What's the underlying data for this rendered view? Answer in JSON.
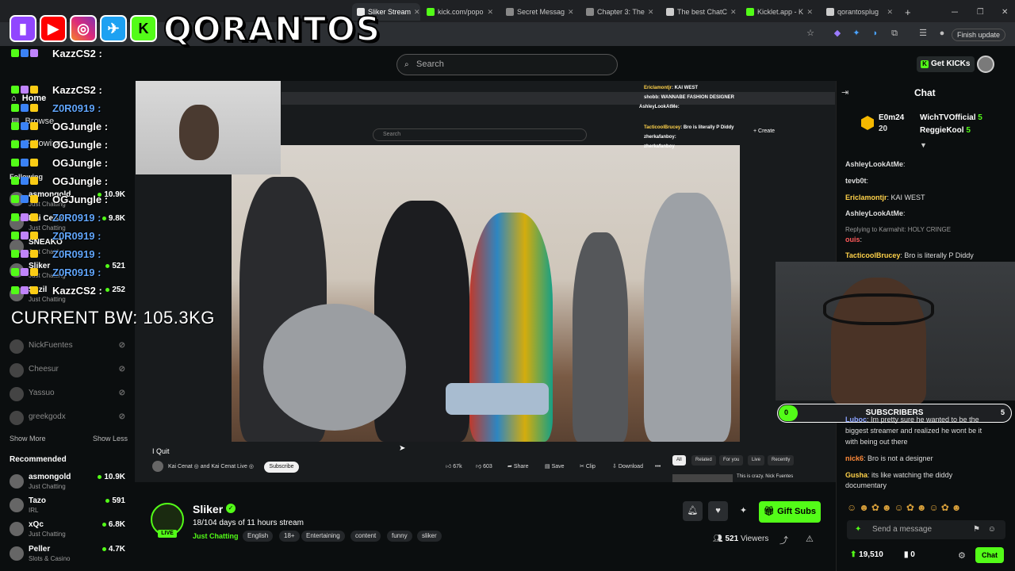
{
  "browser": {
    "tabs": [
      {
        "label": "Sliker Stream",
        "active": true,
        "color": "#e8e8e8"
      },
      {
        "label": "kick.com/popo",
        "color": "#53fc18"
      },
      {
        "label": "Secret Messag",
        "color": "#888888"
      },
      {
        "label": "Chapter 3: The",
        "color": "#888888"
      },
      {
        "label": "The best ChatC",
        "color": "#cccccc"
      },
      {
        "label": "Kicklet.app - K",
        "color": "#53fc18"
      },
      {
        "label": "qorantosplug",
        "color": "#cccccc"
      }
    ],
    "finish_update": "Finish update",
    "new_tab": "+"
  },
  "overlay": {
    "brand": "QORANTOS",
    "social_icons": [
      "twitch-icon",
      "youtube-icon",
      "instagram-icon",
      "twitter-icon",
      "kick-icon"
    ],
    "bw_counter": "CURRENT BW: 105.3KG",
    "chat": [
      {
        "name": "KazzCS2",
        "sep": ":",
        "color": "#ffffff"
      },
      {
        "name": "KazzCS2",
        "sep": ":",
        "color": "#ffffff"
      },
      {
        "name": "Z0R0919",
        "sep": ":",
        "color": "#3b82f6"
      },
      {
        "name": "OGJungle",
        "sep": ":",
        "color": "#ffffff"
      },
      {
        "name": "OGJungle",
        "sep": ":",
        "color": "#ffffff"
      },
      {
        "name": "OGJungle",
        "sep": ":",
        "color": "#ffffff"
      },
      {
        "name": "OGJungle",
        "sep": ":",
        "color": "#ffffff"
      },
      {
        "name": "OGJungle",
        "sep": ":",
        "color": "#ffffff"
      },
      {
        "name": "Z0R0919",
        "sep": ":",
        "color": "#3b82f6"
      },
      {
        "name": "Z0R0919",
        "sep": ":",
        "color": "#3b82f6"
      },
      {
        "name": "Z0R0919",
        "sep": ":",
        "color": "#3b82f6"
      },
      {
        "name": "Z0R0919",
        "sep": ":",
        "color": "#3b82f6"
      },
      {
        "name": "KazzCS2",
        "sep": ":",
        "color": "#ffffff"
      }
    ]
  },
  "header": {
    "search_placeholder": "Search",
    "get_kicks": "Get KICKs"
  },
  "sidebar": {
    "nav": [
      {
        "label": "Home"
      },
      {
        "label": "Browse"
      },
      {
        "label": "Following"
      }
    ],
    "section_following": "Following",
    "following": [
      {
        "name": "asmongold",
        "sub": "Just Chatting",
        "count": "10.9K",
        "live": true
      },
      {
        "name": "Kai Cenat",
        "sub": "Just Chatting",
        "count": "9.8K",
        "live": true
      },
      {
        "name": "SNEAKO",
        "sub": "Just Chatting",
        "count": "",
        "live": true
      },
      {
        "name": "Sliker",
        "sub": "Just Chatting",
        "count": "521",
        "live": true
      },
      {
        "name": "Suzil",
        "sub": "Just Chatting",
        "count": "252",
        "live": true
      },
      {
        "name": "NickFuentes",
        "sub": "",
        "count": "",
        "live": false
      },
      {
        "name": "Cheesur",
        "sub": "",
        "count": "",
        "live": false
      },
      {
        "name": "Yassuo",
        "sub": "",
        "count": "",
        "live": false
      },
      {
        "name": "greekgodx",
        "sub": "",
        "count": "",
        "live": false
      }
    ],
    "show_more": "Show More",
    "show_less": "Show Less",
    "section_recommended": "Recommended",
    "recommended": [
      {
        "name": "asmongold",
        "sub": "Just Chatting",
        "count": "10.9K"
      },
      {
        "name": "Tazo",
        "sub": "IRL",
        "count": "591"
      },
      {
        "name": "xQc",
        "sub": "Just Chatting",
        "count": "6.8K"
      },
      {
        "name": "Peller",
        "sub": "Slots & Casino",
        "count": "4.7K"
      }
    ]
  },
  "stream": {
    "inner_search": "Search",
    "inner_create": "+ Create",
    "video_title": "I Quit",
    "video_channel": "Kai Cenat ◎ and Kai Cenat Live ◎",
    "subscribe": "Subscribe",
    "likes": "67k",
    "dislikes": "603",
    "share": "Share",
    "save": "Save",
    "clip": "Clip",
    "download": "Download",
    "chips": [
      "All",
      "Related",
      "For you",
      "Live",
      "Recently"
    ],
    "rec_caption": "This is crazy. Nick Fuentes",
    "mini_chat": [
      {
        "name": "Ericlamontjr",
        "text": ": KAI WEST",
        "color": "#ffd24a"
      },
      {
        "name": "shobb",
        "text": ": WANNABE FASHION DESIGNER",
        "color": "#ffffff"
      },
      {
        "name": "AshleyLookAtMe",
        "text": ":",
        "color": "#ffffff"
      },
      {
        "name": "TacticoolBrucey",
        "text": ": Bro is literally P Diddy",
        "color": "#ffd24a"
      },
      {
        "name": "zherkafanboy",
        "text": ":",
        "color": "#ffffff"
      },
      {
        "name": "zherkafanboy",
        "text": "",
        "color": "#ffffff"
      }
    ]
  },
  "channel": {
    "name": "Sliker",
    "live": "LIVE",
    "title": "18/104 days of 11 hours stream",
    "category": "Just Chatting",
    "tags": [
      "English",
      "18+",
      "Entertaining",
      "content",
      "funny",
      "sliker"
    ],
    "gift_subs": "Gift Subs",
    "viewers": "521",
    "viewers_label": "Viewers"
  },
  "chat": {
    "title": "Chat",
    "leaderboard": [
      {
        "rank_name": "E0m24",
        "value": "20"
      },
      {
        "rank_name": "WichTVOfficial",
        "value": "5"
      },
      {
        "rank_name": "ReggieKool",
        "value": "5"
      }
    ],
    "messages": [
      {
        "name": "AshleyLookAtMe",
        "text": ":",
        "color": "#ffffff"
      },
      {
        "name": "tevb0t",
        "text": ":",
        "color": "#ffffff"
      },
      {
        "name": "Ericlamontjr",
        "text": ": KAI WEST",
        "color": "#ffd24a"
      },
      {
        "name": "AshleyLookAtMe",
        "text": ":",
        "color": "#ffffff"
      },
      {
        "name": "",
        "text": "Replying to Karmahit: HOLY CRINGE",
        "color": "#999999"
      },
      {
        "name": "ouis",
        "text": ":",
        "color": "#ff5a5a"
      },
      {
        "name": "TacticoolBrucey",
        "text": ": Bro is literally P Diddy",
        "color": "#ffd24a"
      },
      {
        "name": "Luboc",
        "text": ": Im pretty sure he wanted to be the",
        "color": "#8aa2ff"
      },
      {
        "name": "",
        "text": "biggest streamer and realized he wont be it",
        "color": "#dddddd"
      },
      {
        "name": "",
        "text": "with      being out there",
        "color": "#dddddd"
      },
      {
        "name": "nick6",
        "text": ": Bro is not a designer",
        "color": "#ff8a3a"
      },
      {
        "name": "Gusha",
        "text": ": its like watching the diddy",
        "color": "#ffd24a"
      },
      {
        "name": "",
        "text": "documentary",
        "color": "#dddddd"
      }
    ],
    "sub_goal_label": "SUBSCRIBERS",
    "sub_goal_current": "0",
    "sub_goal_target": "5",
    "input_placeholder": "Send a message",
    "points": "19,510",
    "kicks": "0",
    "send": "Chat",
    "accent": "#53fc18"
  }
}
